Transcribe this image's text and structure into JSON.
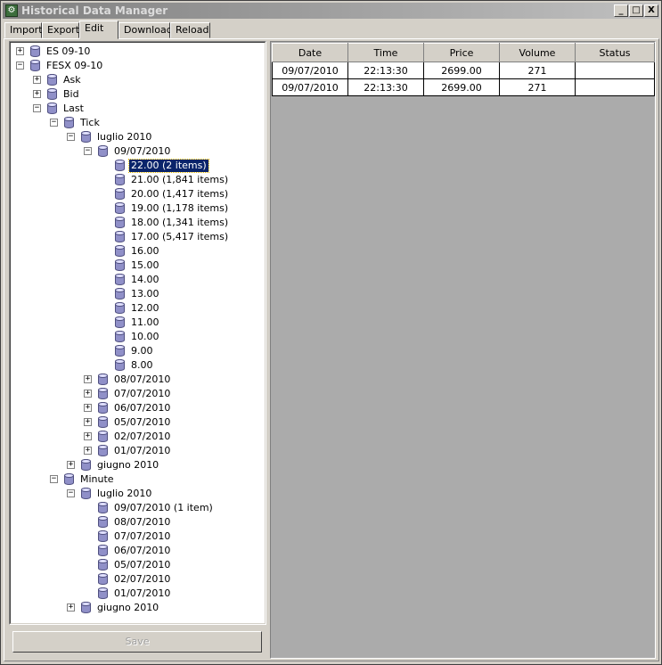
{
  "window": {
    "title": "Historical Data Manager",
    "minimize": "_",
    "maximize": "□",
    "close": "X"
  },
  "tabs": [
    {
      "label": "Import"
    },
    {
      "label": "Export"
    },
    {
      "label": "Edit",
      "active": true
    },
    {
      "label": "Download"
    },
    {
      "label": "Reload"
    }
  ],
  "tree": [
    {
      "label": "ES 09-10",
      "expander": "+"
    },
    {
      "label": "FESX 09-10",
      "expander": "−"
    },
    {
      "label": "Ask",
      "expander": "+"
    },
    {
      "label": "Bid",
      "expander": "+"
    },
    {
      "label": "Last",
      "expander": "−"
    },
    {
      "label": "Tick",
      "expander": "−"
    },
    {
      "label": "luglio 2010",
      "expander": "−"
    },
    {
      "label": "09/07/2010",
      "expander": "−"
    },
    {
      "label": "22.00 (2 items)",
      "selected": true
    },
    {
      "label": "21.00 (1,841 items)"
    },
    {
      "label": "20.00 (1,417 items)"
    },
    {
      "label": "19.00 (1,178 items)"
    },
    {
      "label": "18.00 (1,341 items)"
    },
    {
      "label": "17.00 (5,417 items)"
    },
    {
      "label": "16.00"
    },
    {
      "label": "15.00"
    },
    {
      "label": "14.00"
    },
    {
      "label": "13.00"
    },
    {
      "label": "12.00"
    },
    {
      "label": "11.00"
    },
    {
      "label": "10.00"
    },
    {
      "label": "9.00"
    },
    {
      "label": "8.00"
    },
    {
      "label": "08/07/2010",
      "expander": "+"
    },
    {
      "label": "07/07/2010",
      "expander": "+"
    },
    {
      "label": "06/07/2010",
      "expander": "+"
    },
    {
      "label": "05/07/2010",
      "expander": "+"
    },
    {
      "label": "02/07/2010",
      "expander": "+"
    },
    {
      "label": "01/07/2010",
      "expander": "+"
    },
    {
      "label": "giugno 2010",
      "expander": "+"
    },
    {
      "label": "Minute",
      "expander": "−"
    },
    {
      "label": "luglio 2010",
      "expander": "−"
    },
    {
      "label": "09/07/2010 (1 item)"
    },
    {
      "label": "08/07/2010"
    },
    {
      "label": "07/07/2010"
    },
    {
      "label": "06/07/2010"
    },
    {
      "label": "05/07/2010"
    },
    {
      "label": "02/07/2010"
    },
    {
      "label": "01/07/2010"
    },
    {
      "label": "giugno 2010",
      "expander": "+"
    }
  ],
  "save_label": "Save",
  "table": {
    "columns": [
      "Date",
      "Time",
      "Price",
      "Volume",
      "Status"
    ],
    "rows": [
      [
        "09/07/2010",
        "22:13:30",
        "2699.00",
        "271",
        ""
      ],
      [
        "09/07/2010",
        "22:13:30",
        "2699.00",
        "271",
        ""
      ]
    ]
  },
  "colors": {
    "selection": "#0a246a",
    "window_bg": "#d4d0c8",
    "grid_bg": "#ababab"
  }
}
